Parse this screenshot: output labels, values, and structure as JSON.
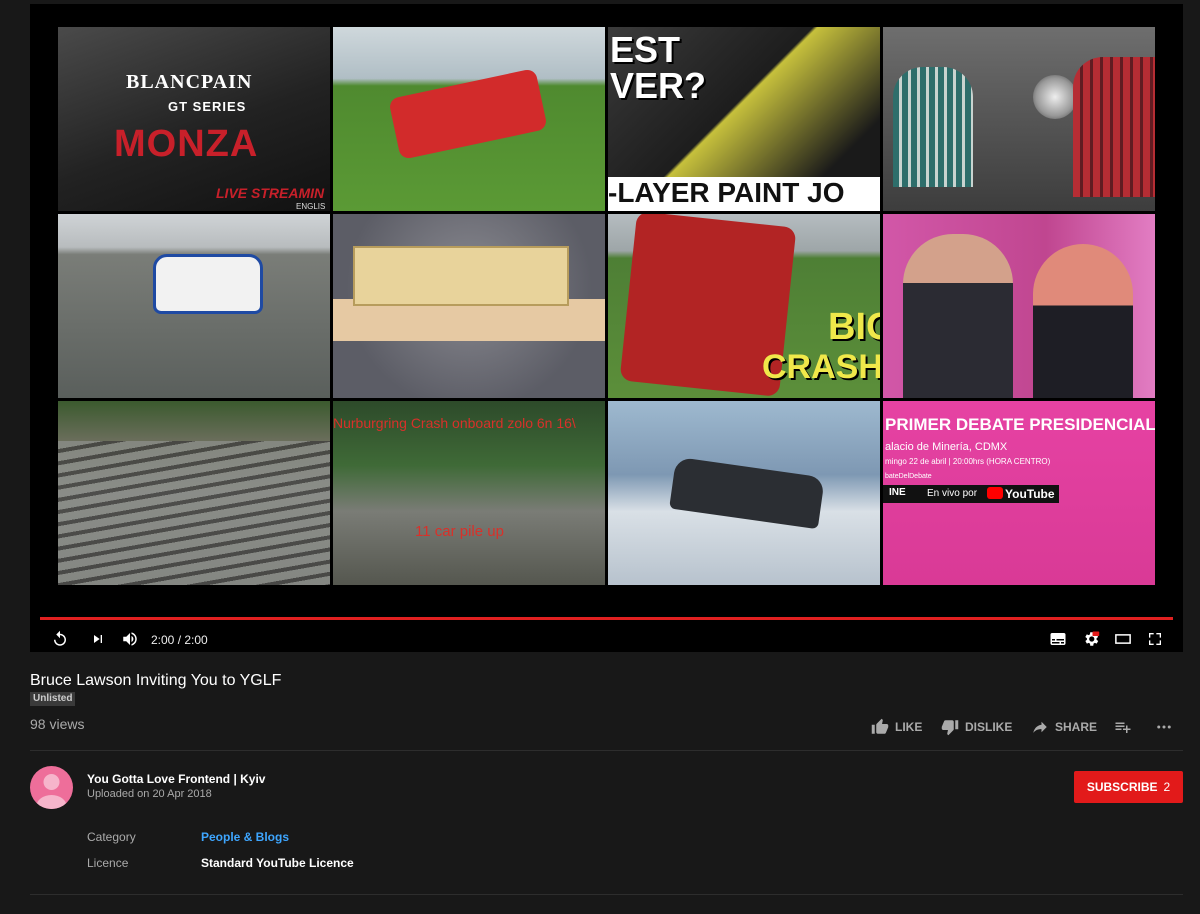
{
  "player": {
    "time_display": "2:00 / 2:00",
    "progress_fraction": 1.0,
    "tiles": {
      "t1": {
        "logo": "BLANCPAIN",
        "sub": "GT SERIES",
        "big": "MONZA",
        "live": "LIVE STREAMIN",
        "lang": "ENGLIS"
      },
      "t3": {
        "line1": "EST",
        "line2": "VER?",
        "line3": "-LAYER PAINT JO"
      },
      "t7": {
        "line1": "BIG",
        "line2": "CRASH"
      },
      "t10": {
        "line1": "Nurburgring Crash onboard zolo 6n 16\\",
        "line2": "11 car pile up"
      },
      "t12": {
        "line1": "PRIMER DEBATE PRESIDENCIAL",
        "line2": "alacio de Minería, CDMX",
        "line3": "mingo 22 de abril | 20:00hrs (HORA CENTRO)",
        "line4": "bateDelDebate",
        "line5": "INE",
        "line6": "En vivo por",
        "line7": "YouTube"
      }
    }
  },
  "video": {
    "title": "Bruce Lawson Inviting You to YGLF",
    "badge": "Unlisted",
    "views": "98 views",
    "actions": {
      "like": "LIKE",
      "dislike": "DISLIKE",
      "share": "SHARE"
    }
  },
  "channel": {
    "name": "You Gotta Love Frontend | Kyiv",
    "uploaded": "Uploaded on 20 Apr 2018",
    "subscribe_label": "SUBSCRIBE",
    "subscriber_count": "2"
  },
  "meta": {
    "category_label": "Category",
    "category_value": "People & Blogs",
    "licence_label": "Licence",
    "licence_value": "Standard YouTube Licence"
  },
  "colors": {
    "accent": "#e21a1a",
    "link": "#3ea6ff",
    "background": "#181818"
  }
}
